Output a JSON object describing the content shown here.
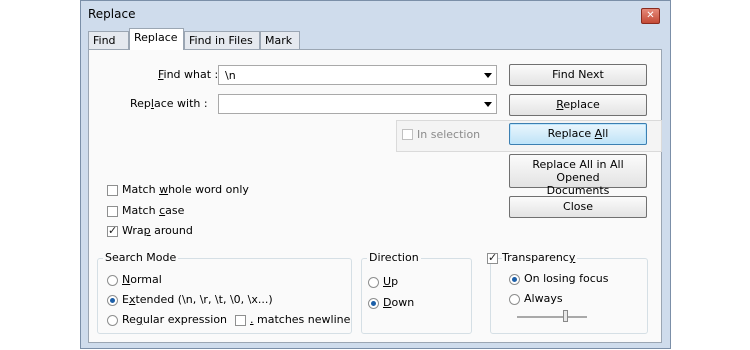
{
  "window": {
    "title": "Replace",
    "close_glyph": "✕"
  },
  "tabs": [
    {
      "label": "Find",
      "active": false
    },
    {
      "label": "Replace",
      "active": true
    },
    {
      "label": "Find in Files",
      "active": false
    },
    {
      "label": "Mark",
      "active": false
    }
  ],
  "find": {
    "label_pre": "",
    "label_ul": "F",
    "label_post": "ind what :",
    "value": "\\n"
  },
  "replace_field": {
    "label_pre": "Rep",
    "label_ul": "l",
    "label_post": "ace with :",
    "value": ""
  },
  "buttons": {
    "find_next": "Find Next",
    "replace_pre": "",
    "replace_ul": "R",
    "replace_post": "eplace",
    "replace_all_pre": "Replace ",
    "replace_all_ul": "A",
    "replace_all_post": "ll",
    "replace_all_docs_line1": "Replace All in All Opened",
    "replace_all_docs_line2": "Documents",
    "close": "Close"
  },
  "in_selection": {
    "label": "In selection",
    "checked": false,
    "enabled": false
  },
  "options": {
    "whole_word": {
      "pre": "Match ",
      "ul": "w",
      "post": "hole word only",
      "checked": false
    },
    "match_case": {
      "pre": "Match ",
      "ul": "c",
      "post": "ase",
      "checked": false
    },
    "wrap_around": {
      "pre": "Wra",
      "ul": "p",
      "post": " around",
      "checked": true
    }
  },
  "search_mode": {
    "title": "Search Mode",
    "normal": {
      "pre": "",
      "ul": "N",
      "post": "ormal",
      "selected": false
    },
    "extended": {
      "pre": "E",
      "ul": "x",
      "post": "tended (\\n, \\r, \\t, \\0, \\x...)",
      "selected": true
    },
    "regex": {
      "pre": "Re",
      "ul": "g",
      "post": "ular expression",
      "selected": false
    },
    "matches_newline": {
      "ul": ".",
      "post": " matches newline",
      "checked": false
    }
  },
  "direction": {
    "title": "Direction",
    "up": {
      "ul": "U",
      "post": "p",
      "selected": false
    },
    "down": {
      "ul": "D",
      "post": "own",
      "selected": true
    }
  },
  "transparency": {
    "label_pre": "Transparenc",
    "label_ul": "y",
    "label_post": "",
    "checked": true,
    "on_losing_focus": {
      "label": "On losing focus",
      "selected": true
    },
    "always": {
      "label": "Always",
      "selected": false
    },
    "level": 0.7
  },
  "colors": {
    "window_bg": "#cfdcec",
    "accent": "#1c5fa8",
    "primary_button_border": "#3c7fb1"
  }
}
